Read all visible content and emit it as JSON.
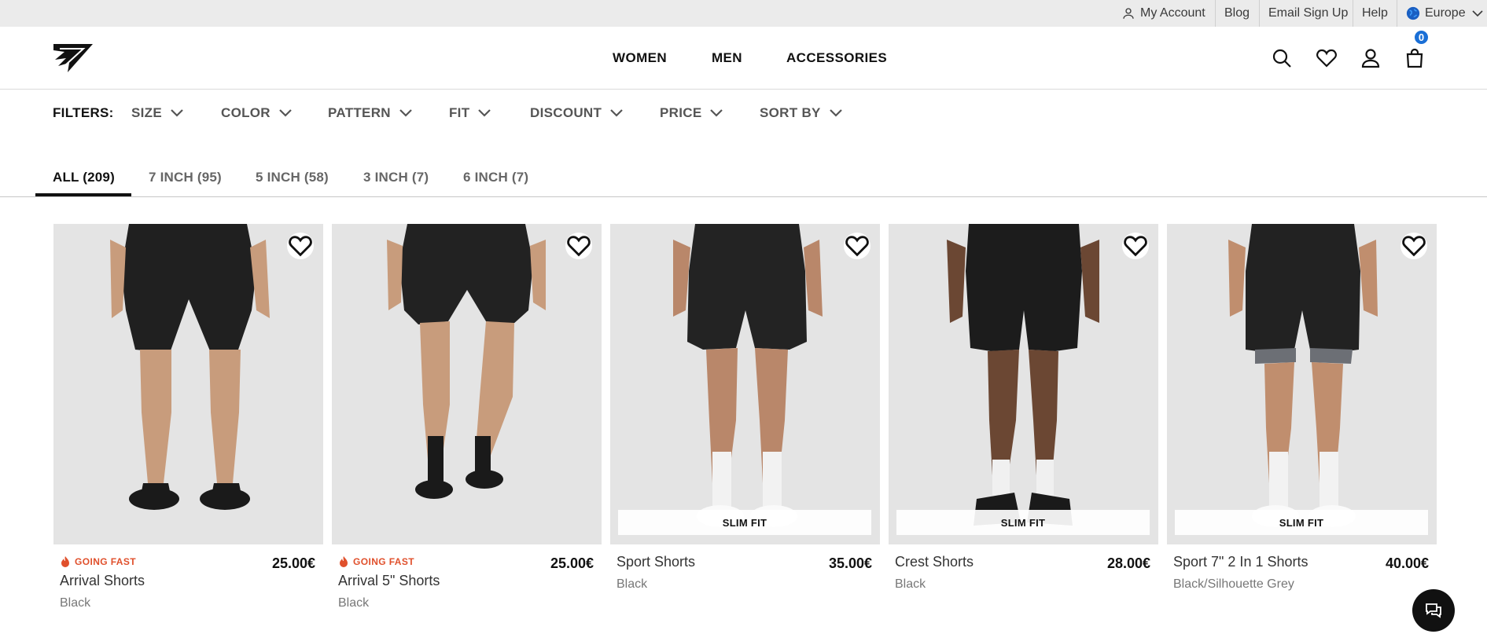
{
  "topbar": {
    "my_account": "My Account",
    "blog": "Blog",
    "email_signup": "Email Sign Up",
    "help": "Help",
    "region": "Europe"
  },
  "header": {
    "logo_icon": "shark-logo",
    "nav": [
      "WOMEN",
      "MEN",
      "ACCESSORIES"
    ],
    "cart_count": "0",
    "accent_color": "#1a6fd6"
  },
  "filters": {
    "label": "FILTERS:",
    "items": [
      "SIZE",
      "COLOR",
      "PATTERN",
      "FIT",
      "DISCOUNT",
      "PRICE",
      "SORT BY"
    ]
  },
  "tabs": {
    "items": [
      "ALL (209)",
      "7 INCH (95)",
      "5 INCH (58)",
      "3 INCH (7)",
      "6 INCH (7)"
    ],
    "active": "ALL (209)"
  },
  "products": [
    {
      "badge": "GOING FAST",
      "name": "Arrival Shorts",
      "color": "Black",
      "price": "25.00€",
      "tag": ""
    },
    {
      "badge": "GOING FAST",
      "name": "Arrival 5\" Shorts",
      "color": "Black",
      "price": "25.00€",
      "tag": ""
    },
    {
      "badge": "",
      "name": "Sport Shorts",
      "color": "Black",
      "price": "35.00€",
      "tag": "SLIM FIT"
    },
    {
      "badge": "",
      "name": "Crest Shorts",
      "color": "Black",
      "price": "28.00€",
      "tag": "SLIM FIT"
    },
    {
      "badge": "",
      "name": "Sport 7\" 2 In 1 Shorts",
      "color": "Black/Silhouette Grey",
      "price": "40.00€",
      "tag": "SLIM FIT"
    }
  ],
  "colors": {
    "badge_orange": "#e0502c",
    "image_bg": "#e4e4e4"
  }
}
